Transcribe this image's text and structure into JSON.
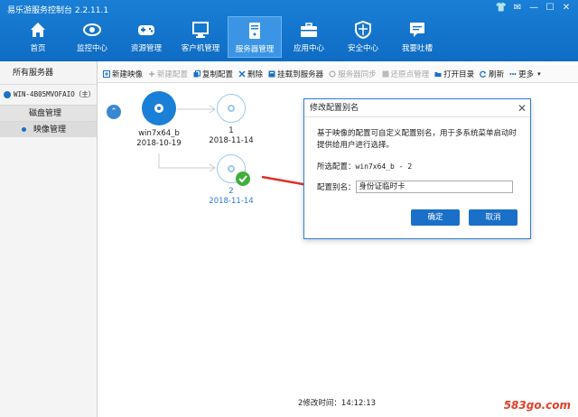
{
  "window": {
    "title": "易乐游服务控制台 2.2.11.1",
    "controls": [
      "👕",
      "✉",
      "—",
      "☐",
      "✕"
    ]
  },
  "nav": [
    {
      "label": "首页",
      "icon": "home-icon"
    },
    {
      "label": "监控中心",
      "icon": "eye-icon"
    },
    {
      "label": "资源管理",
      "icon": "gamepad-icon"
    },
    {
      "label": "客户机管理",
      "icon": "monitor-icon"
    },
    {
      "label": "服务器管理",
      "icon": "server-icon",
      "active": true
    },
    {
      "label": "应用中心",
      "icon": "briefcase-icon"
    },
    {
      "label": "安全中心",
      "icon": "shield-icon"
    },
    {
      "label": "我要吐槽",
      "icon": "chat-icon"
    }
  ],
  "sidebar": {
    "header": "所有服务器",
    "server": "WIN-4B05MVOFAIO（主）",
    "items": [
      "磁盘管理",
      "映像管理"
    ],
    "selected": "映像管理"
  },
  "toolbar": [
    {
      "label": "新建映像",
      "disabled": false,
      "icon": "new-image-icon"
    },
    {
      "label": "新建配置",
      "disabled": true,
      "icon": "plus-icon"
    },
    {
      "label": "复制配置",
      "disabled": false,
      "icon": "copy-icon"
    },
    {
      "label": "删除",
      "disabled": false,
      "icon": "delete-icon"
    },
    {
      "label": "挂载到服务器",
      "disabled": false,
      "icon": "mount-icon"
    },
    {
      "label": "服务器同步",
      "disabled": true,
      "icon": "sync-icon"
    },
    {
      "label": "还原点管理",
      "disabled": true,
      "icon": "restore-icon"
    },
    {
      "label": "打开目录",
      "disabled": false,
      "icon": "folder-icon"
    },
    {
      "label": "刷新",
      "disabled": false,
      "icon": "refresh-icon"
    },
    {
      "label": "更多",
      "disabled": false,
      "icon": "more-icon"
    }
  ],
  "tree": {
    "collapse": "⌃",
    "root": {
      "name": "win7x64_b",
      "date": "2018-10-19"
    },
    "child1": {
      "name": "1",
      "date": "2018-11-14"
    },
    "child2": {
      "name": "2",
      "date": "2018-11-14",
      "selected": true
    }
  },
  "status": "2修改时间：14:12:13",
  "dialog": {
    "title": "修改配置别名",
    "close": "✕",
    "description": "基于映像的配置可自定义配置别名，用于多系统菜单启动时提供给用户进行选择。",
    "selected_label": "所选配置：",
    "selected_value": "win7x64_b - 2",
    "alias_label": "配置别名：",
    "alias_value": "身份证临时卡",
    "ok": "确定",
    "cancel": "取消"
  },
  "watermark": "583go.com",
  "colors": {
    "topbar": "#0f6cc4",
    "accent": "#1a6fc8",
    "check": "#3fae3a",
    "arrow": "#e0302a"
  }
}
